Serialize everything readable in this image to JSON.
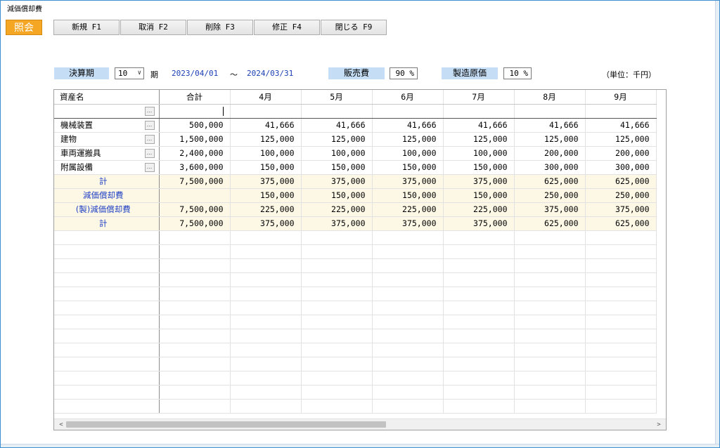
{
  "window": {
    "title": "減価償却費"
  },
  "mode_badge": "照会",
  "toolbar": {
    "buttons": [
      {
        "label": "新規 F1"
      },
      {
        "label": "取消 F2"
      },
      {
        "label": "削除 F3"
      },
      {
        "label": "修正 F4"
      },
      {
        "label": "閉じる F9"
      }
    ]
  },
  "params": {
    "fiscal_label": "決算期",
    "fiscal_value": "10",
    "period_suffix": "期",
    "date_from": "2023/04/01",
    "date_sep": "～",
    "date_to": "2024/03/31",
    "sales_label": "販売費",
    "sales_pct": "90 %",
    "mfg_label": "製造原価",
    "mfg_pct": "10 %",
    "unit_note": "（単位：千円）"
  },
  "grid": {
    "headers": [
      "資産名",
      "合計",
      "4月",
      "5月",
      "6月",
      "7月",
      "8月",
      "9月"
    ],
    "rows": [
      {
        "name": "機械装置",
        "values": [
          "500,000",
          "41,666",
          "41,666",
          "41,666",
          "41,666",
          "41,666",
          "41,666"
        ]
      },
      {
        "name": "建物",
        "values": [
          "1,500,000",
          "125,000",
          "125,000",
          "125,000",
          "125,000",
          "125,000",
          "125,000"
        ]
      },
      {
        "name": "車両運搬具",
        "values": [
          "2,400,000",
          "100,000",
          "100,000",
          "100,000",
          "100,000",
          "200,000",
          "200,000"
        ]
      },
      {
        "name": "附属設備",
        "values": [
          "3,600,000",
          "150,000",
          "150,000",
          "150,000",
          "150,000",
          "300,000",
          "300,000"
        ]
      }
    ],
    "summary_rows": [
      {
        "name": "計",
        "values": [
          "7,500,000",
          "375,000",
          "375,000",
          "375,000",
          "375,000",
          "625,000",
          "625,000"
        ]
      },
      {
        "name": "減価償却費",
        "values": [
          "",
          "150,000",
          "150,000",
          "150,000",
          "150,000",
          "250,000",
          "250,000"
        ]
      },
      {
        "name": "(製)減価償却費",
        "values": [
          "7,500,000",
          "225,000",
          "225,000",
          "225,000",
          "225,000",
          "375,000",
          "375,000"
        ]
      },
      {
        "name": "計",
        "values": [
          "7,500,000",
          "375,000",
          "375,000",
          "375,000",
          "375,000",
          "625,000",
          "625,000"
        ]
      }
    ],
    "ellipsis_label": "...",
    "empty_rows": 13
  },
  "scrollbar": {
    "left_arrow": "<",
    "right_arrow": ">"
  }
}
